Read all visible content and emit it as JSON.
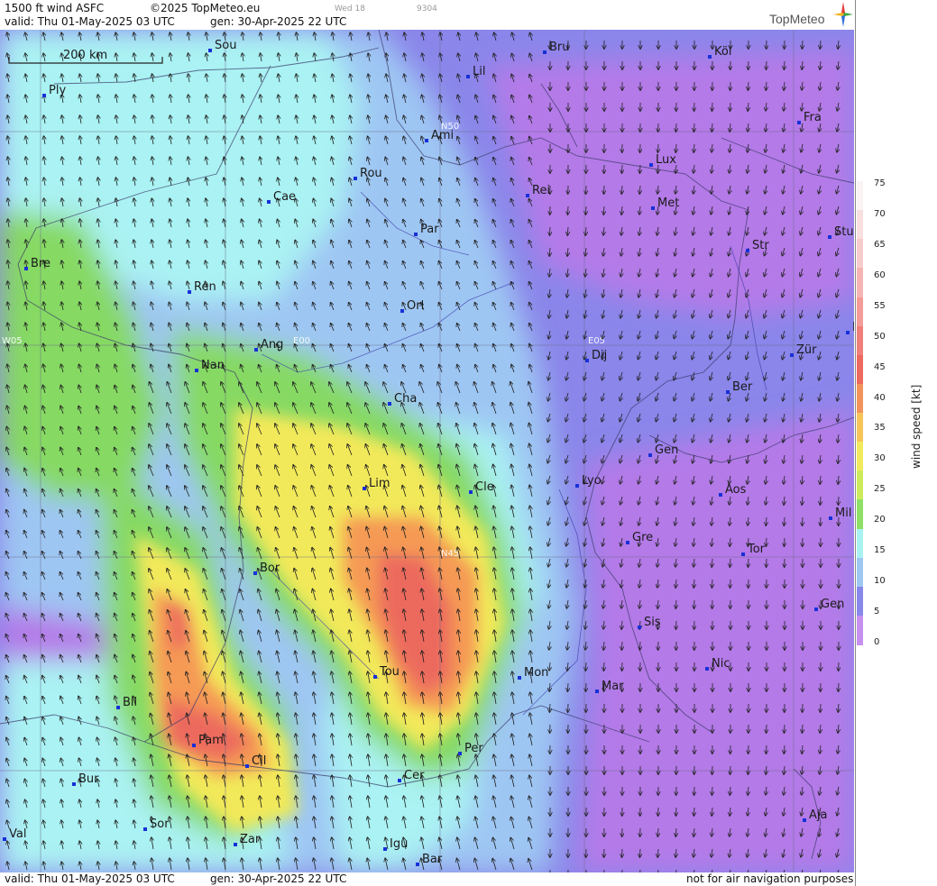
{
  "header": {
    "product": "1500 ft wind ASFC",
    "copyright": "©2025 TopMeteo.eu",
    "valid": "valid:  Thu  01-May-2025  03 UTC",
    "generated": "gen: 30-Apr-2025 22 UTC",
    "small_a": "Wed 18",
    "small_b": "9304",
    "brand": "TopMeteo"
  },
  "footer": {
    "valid": "valid:  Thu  01-May-2025  03 UTC",
    "generated": "gen: 30-Apr-2025 22 UTC",
    "disclaimer": "not for air navigation purposes"
  },
  "scale_bar": {
    "label": "200 km"
  },
  "grid_labels": {
    "n50": "N50",
    "n45": "N45",
    "w05": "W05",
    "e00": "E00",
    "e05": "E05"
  },
  "cities": [
    "Sou",
    "Ply",
    "Lil",
    "Bru",
    "Köl",
    "Ami",
    "Fra",
    "Lux",
    "Rou",
    "Cae",
    "Rei",
    "Met",
    "Par",
    "Bre",
    "Str",
    "Stu",
    "Ren",
    "Orl",
    "Ang",
    "Nan",
    "Dij",
    "Zür",
    "Ber",
    "Cha",
    "Gen",
    "Lim",
    "Cle",
    "Lyo",
    "Aos",
    "Mil",
    "Gre",
    "Tor",
    "Bor",
    "Sis",
    "Gen",
    "Tou",
    "Mon",
    "Mar",
    "Nic",
    "Bil",
    "Pam",
    "Per",
    "Cil",
    "Cer",
    "Bur",
    "Sor",
    "Aja",
    "Val",
    "Zar",
    "Igu",
    "Bar",
    "F"
  ],
  "legend": {
    "title": "wind speed [kt]",
    "ticks": [
      "75",
      "70",
      "65",
      "60",
      "55",
      "50",
      "45",
      "40",
      "35",
      "30",
      "25",
      "20",
      "15",
      "10",
      "5",
      "0"
    ],
    "colors": [
      "#fbf4f4",
      "#f9e0e0",
      "#f7cccc",
      "#f5b5b3",
      "#f49c98",
      "#f07f7a",
      "#ec6a5e",
      "#f1935a",
      "#f7c45a",
      "#f2ea5e",
      "#cdea5c",
      "#8ee066",
      "#a9f2f2",
      "#9ec8f2",
      "#8888ea",
      "#c690ee"
    ]
  },
  "colors": {
    "calm": "#b47ae8",
    "light": "#8a86ea",
    "moderate": "#9ec6f3",
    "fresh": "#aaf2f3",
    "strong": "#86d964",
    "gale": "#f2e95a",
    "stormy": "#f59a55",
    "storm": "#ec6b5d"
  }
}
